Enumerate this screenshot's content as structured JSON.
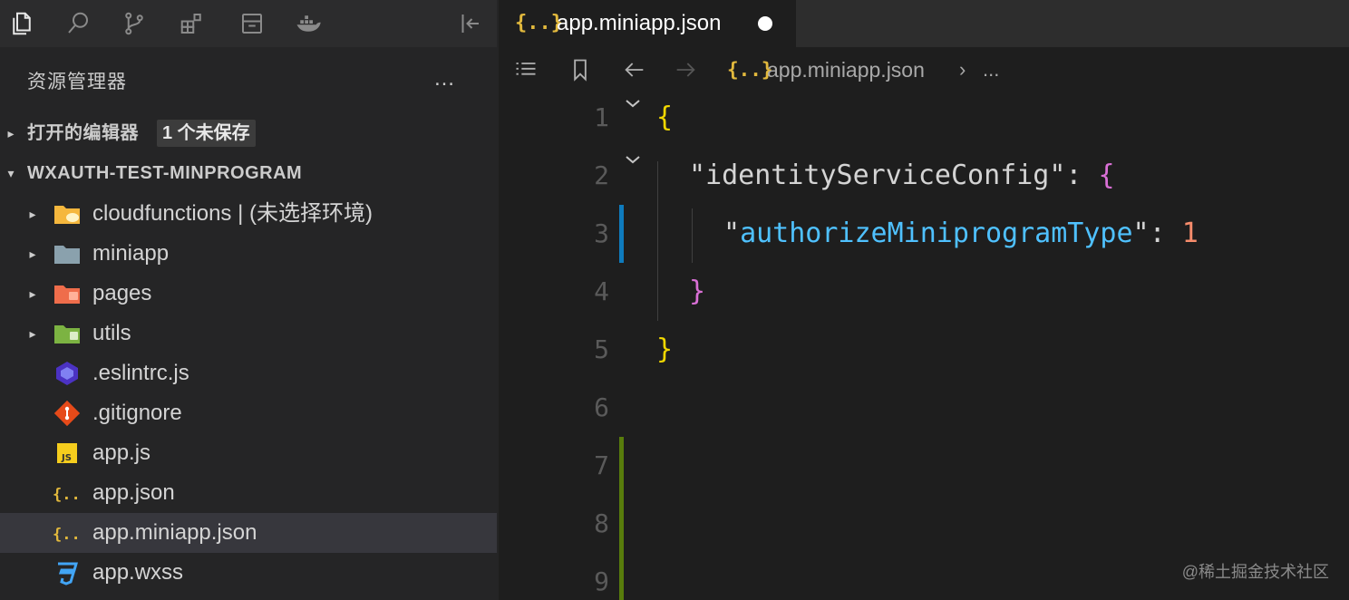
{
  "sidebar": {
    "title": "资源管理器",
    "more": "…",
    "open_editors": {
      "label": "打开的编辑器",
      "badge": "1 个未保存"
    },
    "workspace": {
      "label": "WXAUTH-TEST-MINPROGRAM"
    },
    "items": [
      {
        "name": "cloudfunctions | (未选择环境)",
        "type": "folder",
        "icon": "cloud-folder-icon",
        "color": "#f5b73d"
      },
      {
        "name": "miniapp",
        "type": "folder",
        "icon": "folder-icon",
        "color": "#8aa1ad"
      },
      {
        "name": "pages",
        "type": "folder",
        "icon": "pages-folder-icon",
        "color": "#ef6d4b"
      },
      {
        "name": "utils",
        "type": "folder",
        "icon": "utils-folder-icon",
        "color": "#7cb342"
      },
      {
        "name": ".eslintrc.js",
        "type": "file",
        "icon": "eslint-icon",
        "color": "#4b32c3"
      },
      {
        "name": ".gitignore",
        "type": "file",
        "icon": "git-icon",
        "color": "#e64a19"
      },
      {
        "name": "app.js",
        "type": "file",
        "icon": "js-file-icon",
        "color": "#f5cd1d"
      },
      {
        "name": "app.json",
        "type": "file",
        "icon": "json-file-icon",
        "color": "#e2b93d"
      },
      {
        "name": "app.miniapp.json",
        "type": "file",
        "icon": "json-file-icon",
        "color": "#e2b93d",
        "selected": true
      },
      {
        "name": "app.wxss",
        "type": "file",
        "icon": "css-file-icon",
        "color": "#42a5f5"
      }
    ]
  },
  "editor": {
    "tab": {
      "icon_text": "{..}",
      "label": "app.miniapp.json"
    },
    "breadcrumb": {
      "icon_text": "{..}",
      "file": "app.miniapp.json",
      "sep": "›",
      "more": "..."
    },
    "lines": [
      {
        "num": "1",
        "text": "{"
      },
      {
        "num": "2",
        "key": "identityServiceConfig",
        "open": "{"
      },
      {
        "num": "3",
        "key": "authorizeMiniprogramType",
        "value": "1"
      },
      {
        "num": "4",
        "text": "}"
      },
      {
        "num": "5",
        "text": "}"
      },
      {
        "num": "6"
      },
      {
        "num": "7"
      },
      {
        "num": "8"
      },
      {
        "num": "9"
      }
    ]
  },
  "watermark": "@稀土掘金技术社区",
  "colors": {
    "sidebar_bg": "#252526",
    "editor_bg": "#1e1e1e",
    "selected_bg": "#37373d",
    "json_icon": "#e2b93d",
    "modified_gutter": "#0e7bbd",
    "added_gutter": "#587c0c"
  }
}
